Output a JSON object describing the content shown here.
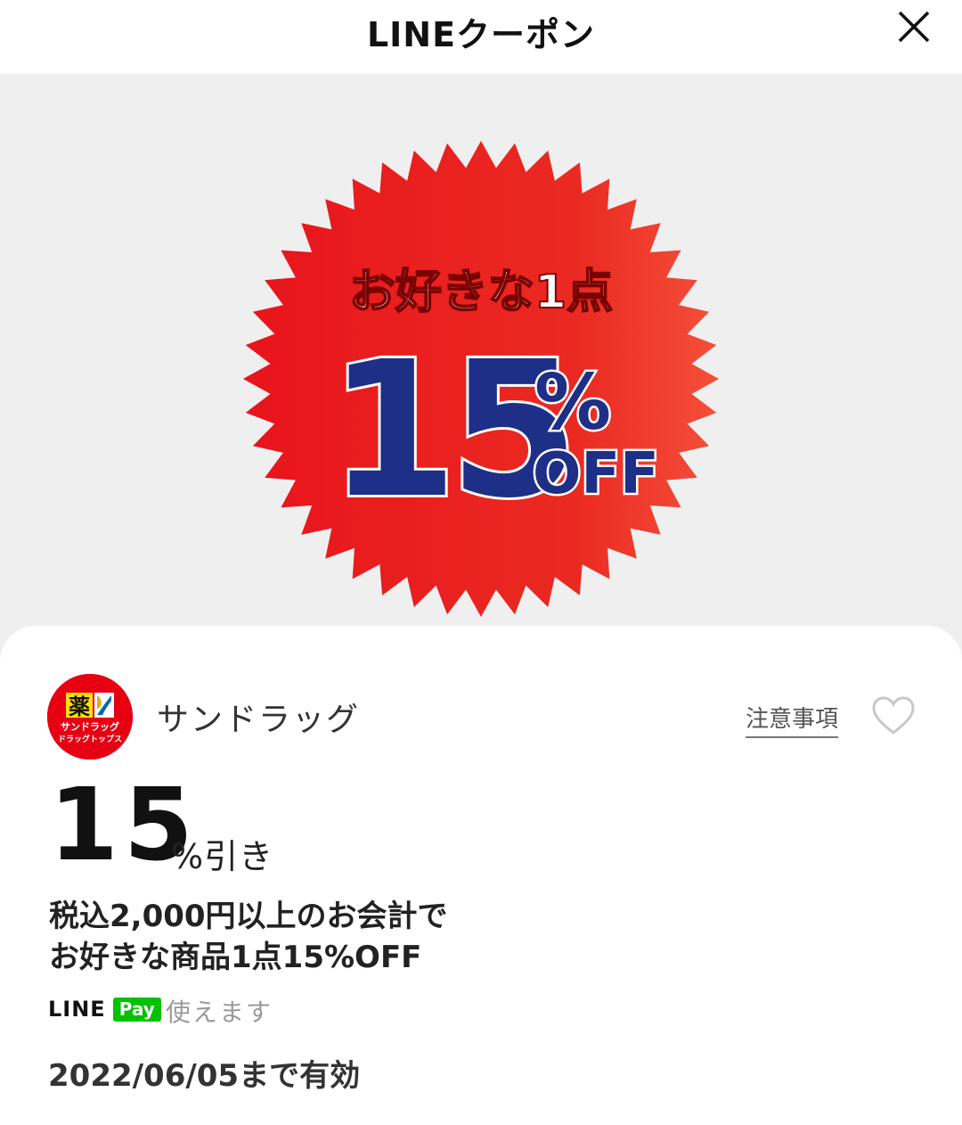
{
  "header": {
    "title": "LINEクーポン"
  },
  "hero": {
    "line1": "お好きな1点",
    "amount": "15",
    "percent": "%",
    "off": "OFF",
    "colors": {
      "burst": "#e8141c",
      "amount": "#1d2f86"
    }
  },
  "store": {
    "name": "サンドラッグ",
    "logo_char": "薬",
    "logo_sub1": "サンドラッグ",
    "logo_sub2": "ドラッグトップス"
  },
  "actions": {
    "notes_label": "注意事項"
  },
  "coupon": {
    "discount_value": "15",
    "discount_unit": "%引き",
    "description_lines": [
      "税込2,000円以上のお会計で",
      "お好きな商品1点15%OFF"
    ],
    "payment_logo_line": "LINE",
    "payment_logo_pay": "Pay",
    "payment_text": "使えます",
    "expiry": "2022/06/05まで有効"
  }
}
